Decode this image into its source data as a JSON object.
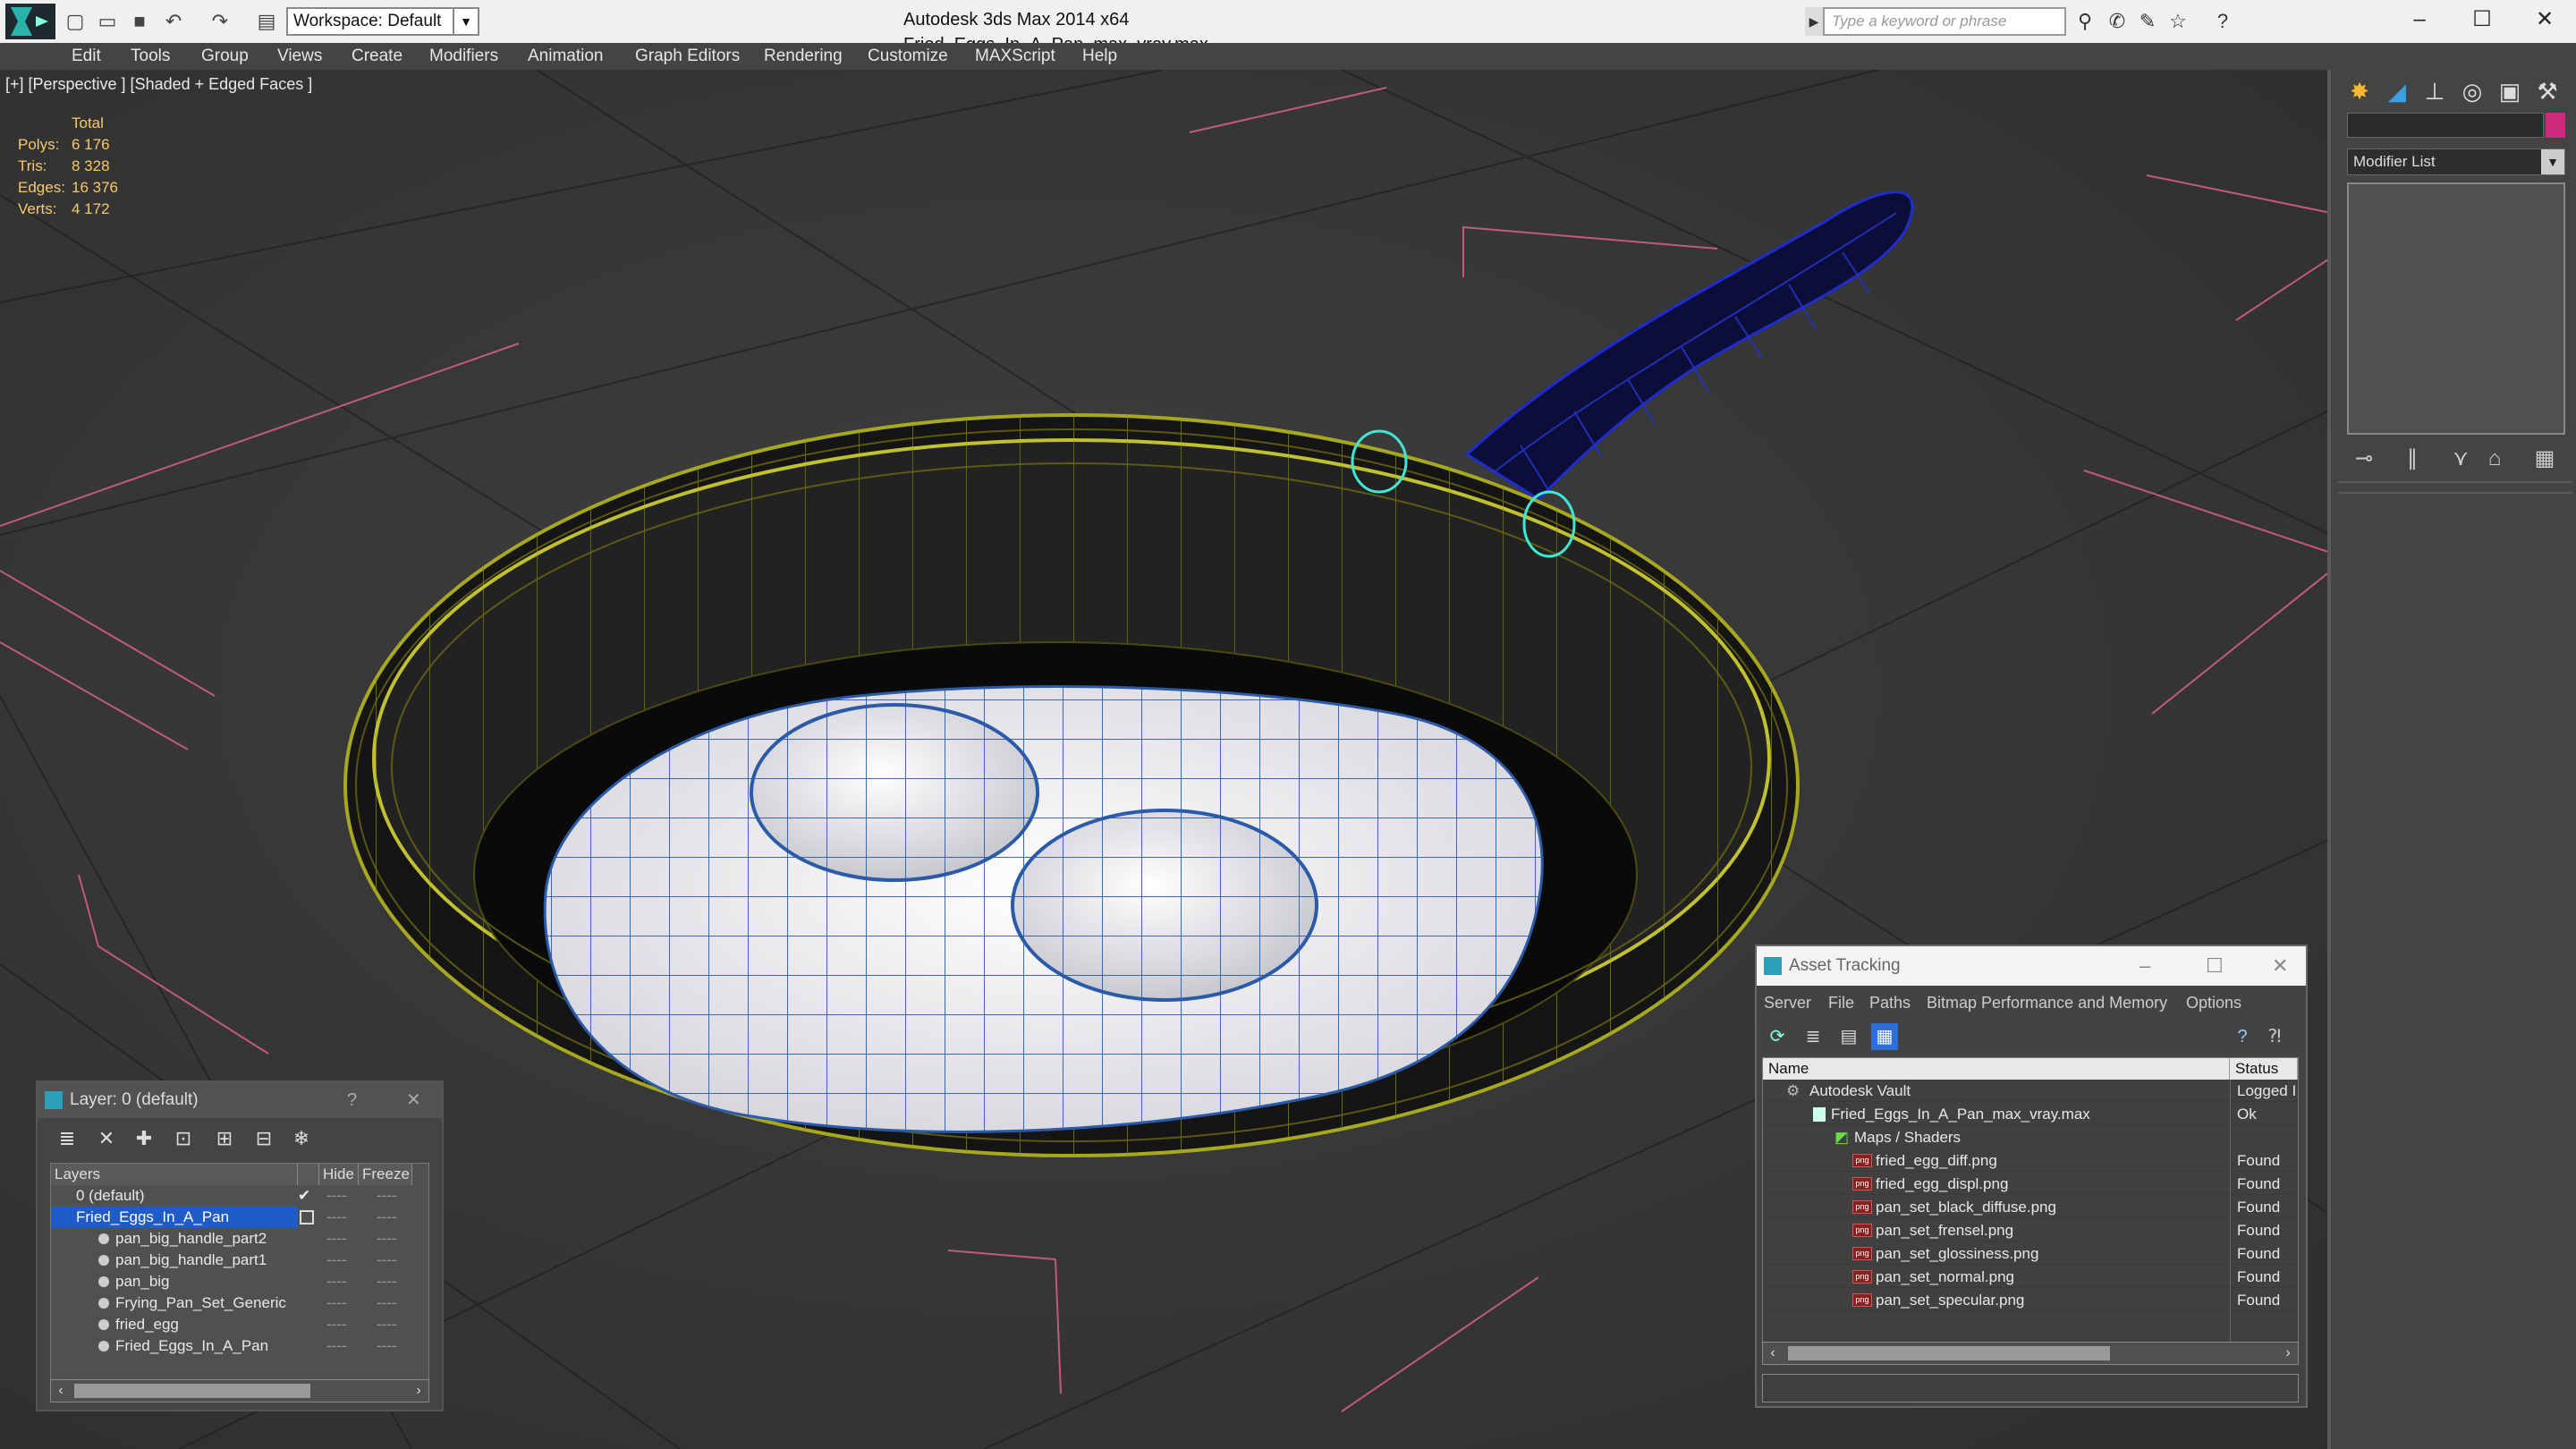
{
  "window": {
    "app_title": "Autodesk 3ds Max  2014 x64",
    "file_title": "Fried_Eggs_In_A_Pan_max_vray.max"
  },
  "toolbar": {
    "workspace": "Workspace: Default",
    "search_placeholder": "Type a keyword or phrase"
  },
  "menu": [
    "Edit",
    "Tools",
    "Group",
    "Views",
    "Create",
    "Modifiers",
    "Animation",
    "Graph Editors",
    "Rendering",
    "Customize",
    "MAXScript",
    "Help"
  ],
  "viewport": {
    "label": "[+] [Perspective ] [Shaded + Edged Faces ]",
    "stats": {
      "header": "Total",
      "rows": [
        {
          "key": "Polys:",
          "value": "6 176"
        },
        {
          "key": "Tris:",
          "value": "8 328"
        },
        {
          "key": "Edges:",
          "value": "16 376"
        },
        {
          "key": "Verts:",
          "value": "4 172"
        }
      ]
    }
  },
  "command_panel": {
    "modifier_list": "Modifier List",
    "object_color": "#cc2a7a"
  },
  "layer_panel": {
    "title": "Layer: 0 (default)",
    "help": "?",
    "columns": {
      "layers": "Layers",
      "hide": "Hide",
      "freeze": "Freeze"
    },
    "rows": [
      {
        "name": "0 (default)",
        "hide": "----",
        "freeze": "----"
      },
      {
        "name": "Fried_Eggs_In_A_Pan",
        "hide": "----",
        "freeze": "----"
      },
      {
        "name": "pan_big_handle_part2",
        "hide": "----",
        "freeze": "----"
      },
      {
        "name": "pan_big_handle_part1",
        "hide": "----",
        "freeze": "----"
      },
      {
        "name": "pan_big",
        "hide": "----",
        "freeze": "----"
      },
      {
        "name": "Frying_Pan_Set_Generic",
        "hide": "----",
        "freeze": "----"
      },
      {
        "name": "fried_egg",
        "hide": "----",
        "freeze": "----"
      },
      {
        "name": "Fried_Eggs_In_A_Pan",
        "hide": "----",
        "freeze": "----"
      }
    ]
  },
  "asset_tracking": {
    "title": "Asset Tracking",
    "menu": [
      "Server",
      "File",
      "Paths",
      "Bitmap Performance and Memory",
      "Options"
    ],
    "columns": {
      "name": "Name",
      "status": "Status"
    },
    "rows": [
      {
        "name": "Autodesk Vault",
        "status": "Logged I"
      },
      {
        "name": "Fried_Eggs_In_A_Pan_max_vray.max",
        "status": "Ok"
      },
      {
        "name": "Maps / Shaders",
        "status": ""
      },
      {
        "name": "fried_egg_diff.png",
        "status": "Found"
      },
      {
        "name": "fried_egg_displ.png",
        "status": "Found"
      },
      {
        "name": "pan_set_black_diffuse.png",
        "status": "Found"
      },
      {
        "name": "pan_set_frensel.png",
        "status": "Found"
      },
      {
        "name": "pan_set_glossiness.png",
        "status": "Found"
      },
      {
        "name": "pan_set_normal.png",
        "status": "Found"
      },
      {
        "name": "pan_set_specular.png",
        "status": "Found"
      }
    ]
  }
}
